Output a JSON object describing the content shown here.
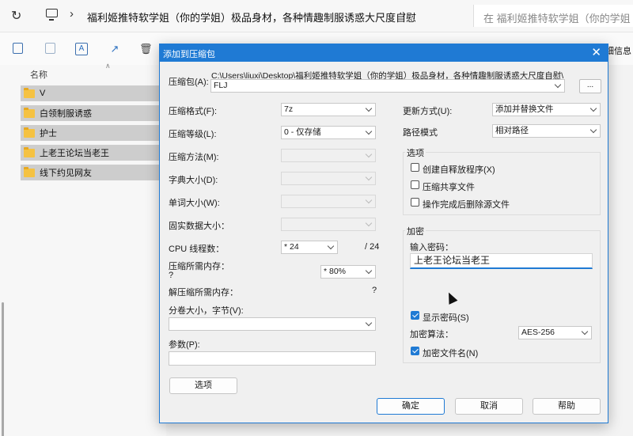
{
  "explorer": {
    "path": "福利姬推特软学姐（你的学姐）极品身材，各种情趣制服诱惑大尺度自慰",
    "search_placeholder": "在 福利姬推特软学姐（你的学姐",
    "details": "详细信息",
    "column_name": "名称",
    "folders": [
      "V",
      "白领制服诱惑",
      "护士",
      "上老王论坛当老王",
      "线下约见网友"
    ]
  },
  "dialog": {
    "title": "添加到压缩包",
    "archive_label": "压缩包(A):",
    "archive_path": "C:\\Users\\liuxi\\Desktop\\福利姬推特软学姐（你的学姐）极品身材，各种情趣制服诱惑大尺度自慰\\",
    "archive_name": "FLJ",
    "browse": "...",
    "left": {
      "format_label": "压缩格式(F):",
      "format_value": "7z",
      "level_label": "压缩等级(L):",
      "level_value": "0 - 仅存储",
      "method_label": "压缩方法(M):",
      "dict_label": "字典大小(D):",
      "word_label": "单词大小(W):",
      "solid_label": "固实数据大小：",
      "cpu_label": "CPU 线程数：",
      "cpu_value": "* 24",
      "cpu_total": "/ 24",
      "mem_comp_label": "压缩所需内存：",
      "mem_comp_value": "?",
      "mem_percent": "* 80%",
      "mem_decomp_label": "解压缩所需内存：",
      "mem_decomp_value": "?",
      "split_label": "分卷大小，字节(V):",
      "params_label": "参数(P):",
      "options_button": "选项"
    },
    "right": {
      "update_label": "更新方式(U):",
      "update_value": "添加并替换文件",
      "path_label": "路径模式",
      "path_value": "相对路径",
      "options_group": "选项",
      "opt_sfx": "创建自释放程序(X)",
      "opt_shared": "压缩共享文件",
      "opt_delete": "操作完成后删除源文件",
      "encrypt_group": "加密",
      "password_label": "输入密码：",
      "password_value": "上老王论坛当老王",
      "show_password": "显示密码(S)",
      "enc_method_label": "加密算法：",
      "enc_method_value": "AES-256",
      "enc_filenames": "加密文件名(N)"
    },
    "buttons": {
      "ok": "确定",
      "cancel": "取消",
      "help": "帮助"
    }
  }
}
